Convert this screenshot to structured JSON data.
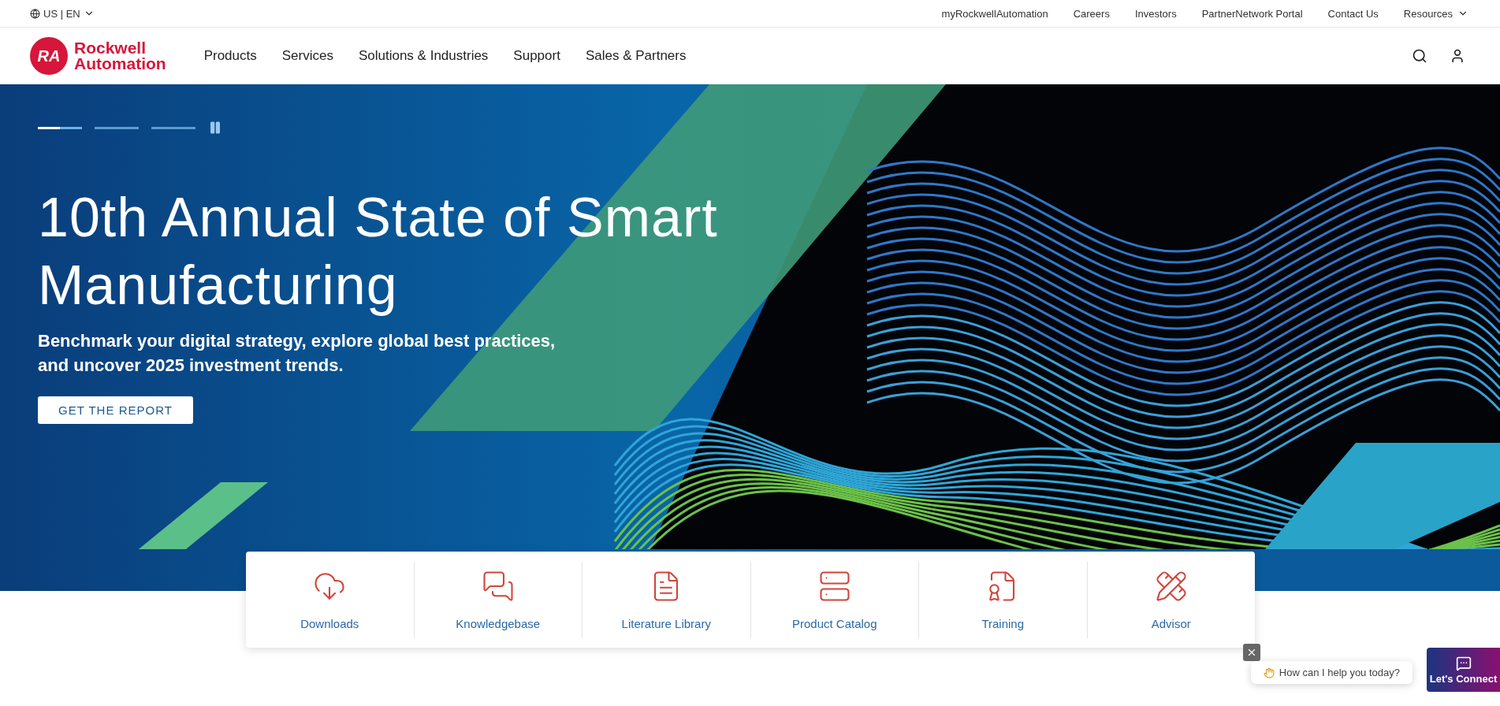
{
  "utility_bar": {
    "locale": "US | EN",
    "links": [
      "myRockwellAutomation",
      "Careers",
      "Investors",
      "PartnerNetwork Portal",
      "Contact Us"
    ],
    "resources": "Resources"
  },
  "header": {
    "logo": {
      "mark": "RA",
      "line1": "Rockwell",
      "line2": "Automation"
    },
    "nav": [
      "Products",
      "Services",
      "Solutions & Industries",
      "Support",
      "Sales & Partners"
    ]
  },
  "hero": {
    "slides": [
      {
        "selected": true,
        "level": 0.5
      },
      {
        "selected": false
      },
      {
        "selected": false
      }
    ],
    "title": "10th Annual State of Smart Manufacturing",
    "subtitle": "Benchmark your digital strategy, explore global best practices, and uncover 2025 investment trends.",
    "cta": "GET THE REPORT"
  },
  "quick_links": [
    {
      "kind": "downloads",
      "label": "Downloads"
    },
    {
      "kind": "knowledgebase",
      "label": "Knowledgebase"
    },
    {
      "kind": "literature",
      "label": "Literature Library"
    },
    {
      "kind": "catalog",
      "label": "Product Catalog"
    },
    {
      "kind": "training",
      "label": "Training"
    },
    {
      "kind": "advisor",
      "label": "Advisor"
    }
  ],
  "chat": {
    "prompt": "How can I help you today?",
    "button": "Let's Connect"
  }
}
